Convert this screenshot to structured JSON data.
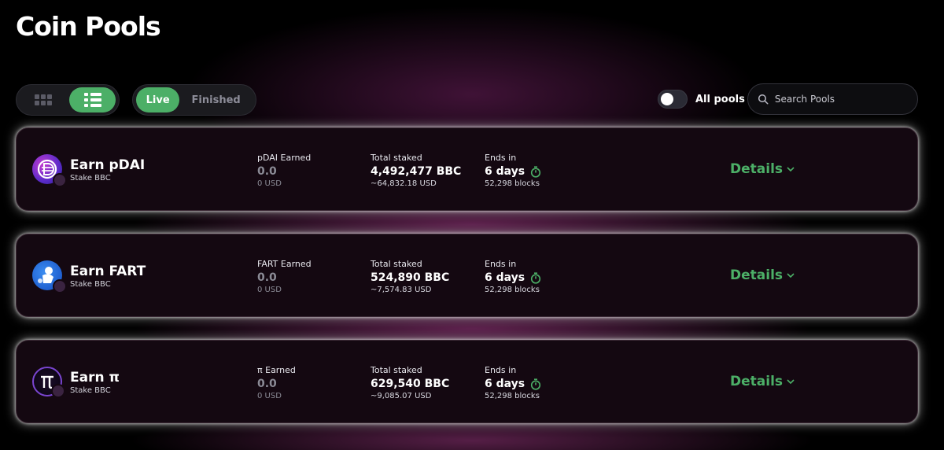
{
  "page": {
    "title": "Coin Pools"
  },
  "toolbar": {
    "view_modes": [
      "grid",
      "list"
    ],
    "active_view": "list",
    "tabs": {
      "live": "Live",
      "finished": "Finished"
    },
    "active_tab": "Live",
    "all_pools_label": "All pools",
    "all_pools_on": false,
    "search_placeholder": "Search Pools"
  },
  "colors": {
    "accent": "#4caf67",
    "card_bg": "#140811",
    "glow": "#b03c8c"
  },
  "pools": [
    {
      "name": "Earn pDAI",
      "sub": "Stake BBC",
      "icon": "pdai-token-icon",
      "earned_label": "pDAI Earned",
      "earned": "0.0",
      "earned_usd": "0 USD",
      "staked_label": "Total staked",
      "staked": "4,492,477 BBC",
      "staked_usd": "~64,832.18 USD",
      "ends_label": "Ends in",
      "ends": "6 days",
      "blocks": "52,298 blocks",
      "details": "Details"
    },
    {
      "name": "Earn FART",
      "sub": "Stake BBC",
      "icon": "fart-token-icon",
      "earned_label": "FART Earned",
      "earned": "0.0",
      "earned_usd": "0 USD",
      "staked_label": "Total staked",
      "staked": "524,890 BBC",
      "staked_usd": "~7,574.83 USD",
      "ends_label": "Ends in",
      "ends": "6 days",
      "blocks": "52,298 blocks",
      "details": "Details"
    },
    {
      "name": "Earn π",
      "sub": "Stake BBC",
      "icon": "pi-token-icon",
      "earned_label": "π Earned",
      "earned": "0.0",
      "earned_usd": "0 USD",
      "staked_label": "Total staked",
      "staked": "629,540 BBC",
      "staked_usd": "~9,085.07 USD",
      "ends_label": "Ends in",
      "ends": "6 days",
      "blocks": "52,298 blocks",
      "details": "Details"
    }
  ]
}
